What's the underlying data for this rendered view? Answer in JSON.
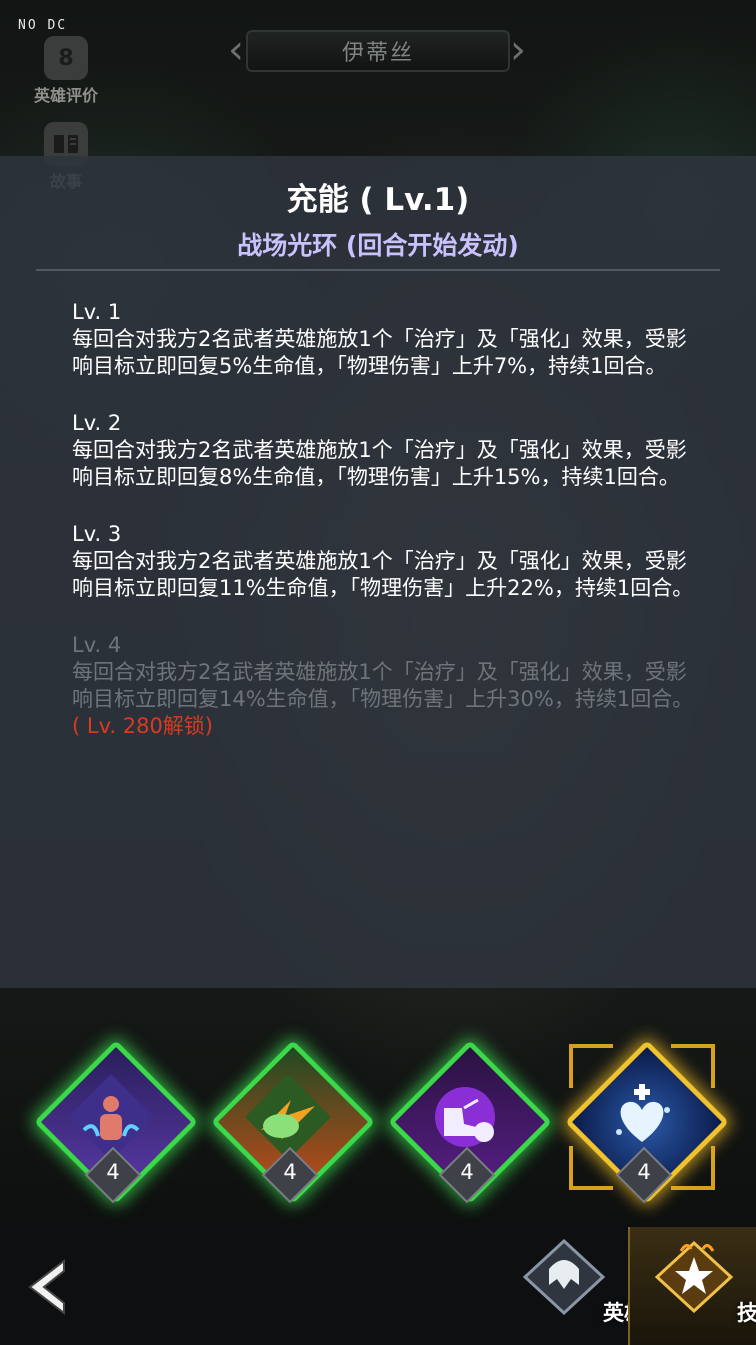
{
  "debug_label": "NO DC",
  "side_menu": [
    {
      "label": "英雄评价",
      "icon": "rating-bubble-icon"
    },
    {
      "label": "故事",
      "icon": "story-book-icon"
    }
  ],
  "hero_selector": {
    "name": "伊蒂丝",
    "prev_icon": "chevron-left-icon",
    "next_icon": "chevron-right-icon"
  },
  "skill_panel": {
    "title": "充能 ( Lv.1)",
    "type": "战场光环 (回合开始发动)",
    "levels": [
      {
        "label": "Lv. 1",
        "text": "每回合对我方2名武者英雄施放1个「治疗」及「强化」效果，受影响目标立即回复5%生命值，「物理伤害」上升7%，持续1回合。"
      },
      {
        "label": "Lv. 2",
        "text": "每回合对我方2名武者英雄施放1个「治疗」及「强化」效果，受影响目标立即回复8%生命值，「物理伤害」上升15%，持续1回合。"
      },
      {
        "label": "Lv. 3",
        "text": "每回合对我方2名武者英雄施放1个「治疗」及「强化」效果，受影响目标立即回复11%生命值，「物理伤害」上升22%，持续1回合。"
      },
      {
        "label": "Lv. 4",
        "text": "每回合对我方2名武者英雄施放1个「治疗」及「强化」效果，受影响目标立即回复14%生命值，「物理伤害」上升30%，持续1回合。",
        "unlock": "( Lv. 280解锁)"
      }
    ]
  },
  "skills": [
    {
      "level": "4",
      "icon": "aura-figure-skill-icon",
      "frame": "green"
    },
    {
      "level": "4",
      "icon": "energy-burst-skill-icon",
      "frame": "green"
    },
    {
      "level": "4",
      "icon": "chained-boot-skill-icon",
      "frame": "green"
    },
    {
      "level": "4",
      "icon": "healing-heart-skill-icon",
      "frame": "gold",
      "selected": true
    }
  ],
  "bottom_nav": {
    "back_icon": "back-arrow-icon",
    "tabs": [
      {
        "label": "英雄",
        "icon": "hero-helmet-icon",
        "active": false
      },
      {
        "label": "技能",
        "icon": "skill-star-icon",
        "active": true
      }
    ]
  },
  "colors": {
    "panel_bg": "#2e343e",
    "subtitle": "#c9c2ff",
    "locked_text": "#6f747b",
    "unlock_text": "#d93a20",
    "green_frame": "#3bd94a",
    "gold_frame": "#f0c22e"
  }
}
